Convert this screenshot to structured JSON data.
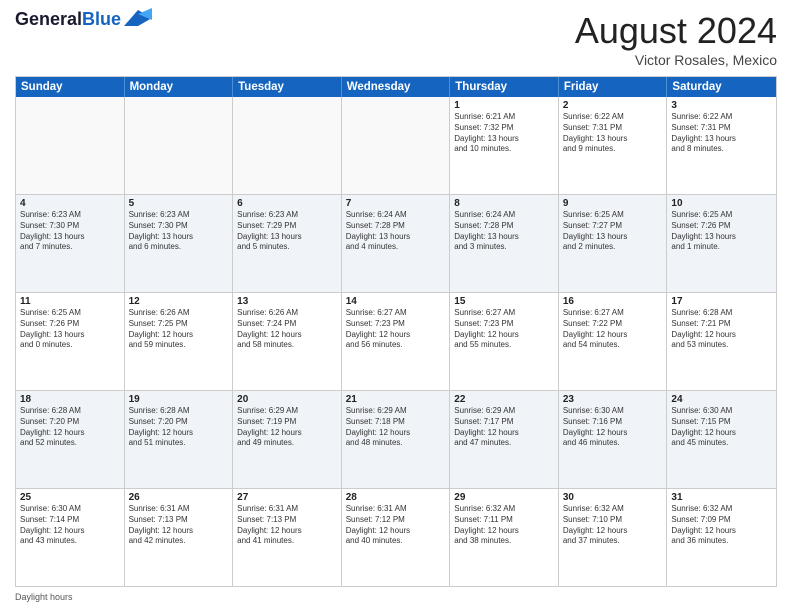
{
  "header": {
    "logo_line1": "General",
    "logo_line2": "Blue",
    "main_title": "August 2024",
    "subtitle": "Victor Rosales, Mexico"
  },
  "calendar": {
    "days_of_week": [
      "Sunday",
      "Monday",
      "Tuesday",
      "Wednesday",
      "Thursday",
      "Friday",
      "Saturday"
    ],
    "weeks": [
      [
        {
          "day": "",
          "empty": true
        },
        {
          "day": "",
          "empty": true
        },
        {
          "day": "",
          "empty": true
        },
        {
          "day": "",
          "empty": true
        },
        {
          "day": "1",
          "lines": [
            "Sunrise: 6:21 AM",
            "Sunset: 7:32 PM",
            "Daylight: 13 hours",
            "and 10 minutes."
          ]
        },
        {
          "day": "2",
          "lines": [
            "Sunrise: 6:22 AM",
            "Sunset: 7:31 PM",
            "Daylight: 13 hours",
            "and 9 minutes."
          ]
        },
        {
          "day": "3",
          "lines": [
            "Sunrise: 6:22 AM",
            "Sunset: 7:31 PM",
            "Daylight: 13 hours",
            "and 8 minutes."
          ]
        }
      ],
      [
        {
          "day": "4",
          "lines": [
            "Sunrise: 6:23 AM",
            "Sunset: 7:30 PM",
            "Daylight: 13 hours",
            "and 7 minutes."
          ]
        },
        {
          "day": "5",
          "lines": [
            "Sunrise: 6:23 AM",
            "Sunset: 7:30 PM",
            "Daylight: 13 hours",
            "and 6 minutes."
          ]
        },
        {
          "day": "6",
          "lines": [
            "Sunrise: 6:23 AM",
            "Sunset: 7:29 PM",
            "Daylight: 13 hours",
            "and 5 minutes."
          ]
        },
        {
          "day": "7",
          "lines": [
            "Sunrise: 6:24 AM",
            "Sunset: 7:28 PM",
            "Daylight: 13 hours",
            "and 4 minutes."
          ]
        },
        {
          "day": "8",
          "lines": [
            "Sunrise: 6:24 AM",
            "Sunset: 7:28 PM",
            "Daylight: 13 hours",
            "and 3 minutes."
          ]
        },
        {
          "day": "9",
          "lines": [
            "Sunrise: 6:25 AM",
            "Sunset: 7:27 PM",
            "Daylight: 13 hours",
            "and 2 minutes."
          ]
        },
        {
          "day": "10",
          "lines": [
            "Sunrise: 6:25 AM",
            "Sunset: 7:26 PM",
            "Daylight: 13 hours",
            "and 1 minute."
          ]
        }
      ],
      [
        {
          "day": "11",
          "lines": [
            "Sunrise: 6:25 AM",
            "Sunset: 7:26 PM",
            "Daylight: 13 hours",
            "and 0 minutes."
          ]
        },
        {
          "day": "12",
          "lines": [
            "Sunrise: 6:26 AM",
            "Sunset: 7:25 PM",
            "Daylight: 12 hours",
            "and 59 minutes."
          ]
        },
        {
          "day": "13",
          "lines": [
            "Sunrise: 6:26 AM",
            "Sunset: 7:24 PM",
            "Daylight: 12 hours",
            "and 58 minutes."
          ]
        },
        {
          "day": "14",
          "lines": [
            "Sunrise: 6:27 AM",
            "Sunset: 7:23 PM",
            "Daylight: 12 hours",
            "and 56 minutes."
          ]
        },
        {
          "day": "15",
          "lines": [
            "Sunrise: 6:27 AM",
            "Sunset: 7:23 PM",
            "Daylight: 12 hours",
            "and 55 minutes."
          ]
        },
        {
          "day": "16",
          "lines": [
            "Sunrise: 6:27 AM",
            "Sunset: 7:22 PM",
            "Daylight: 12 hours",
            "and 54 minutes."
          ]
        },
        {
          "day": "17",
          "lines": [
            "Sunrise: 6:28 AM",
            "Sunset: 7:21 PM",
            "Daylight: 12 hours",
            "and 53 minutes."
          ]
        }
      ],
      [
        {
          "day": "18",
          "lines": [
            "Sunrise: 6:28 AM",
            "Sunset: 7:20 PM",
            "Daylight: 12 hours",
            "and 52 minutes."
          ]
        },
        {
          "day": "19",
          "lines": [
            "Sunrise: 6:28 AM",
            "Sunset: 7:20 PM",
            "Daylight: 12 hours",
            "and 51 minutes."
          ]
        },
        {
          "day": "20",
          "lines": [
            "Sunrise: 6:29 AM",
            "Sunset: 7:19 PM",
            "Daylight: 12 hours",
            "and 49 minutes."
          ]
        },
        {
          "day": "21",
          "lines": [
            "Sunrise: 6:29 AM",
            "Sunset: 7:18 PM",
            "Daylight: 12 hours",
            "and 48 minutes."
          ]
        },
        {
          "day": "22",
          "lines": [
            "Sunrise: 6:29 AM",
            "Sunset: 7:17 PM",
            "Daylight: 12 hours",
            "and 47 minutes."
          ]
        },
        {
          "day": "23",
          "lines": [
            "Sunrise: 6:30 AM",
            "Sunset: 7:16 PM",
            "Daylight: 12 hours",
            "and 46 minutes."
          ]
        },
        {
          "day": "24",
          "lines": [
            "Sunrise: 6:30 AM",
            "Sunset: 7:15 PM",
            "Daylight: 12 hours",
            "and 45 minutes."
          ]
        }
      ],
      [
        {
          "day": "25",
          "lines": [
            "Sunrise: 6:30 AM",
            "Sunset: 7:14 PM",
            "Daylight: 12 hours",
            "and 43 minutes."
          ]
        },
        {
          "day": "26",
          "lines": [
            "Sunrise: 6:31 AM",
            "Sunset: 7:13 PM",
            "Daylight: 12 hours",
            "and 42 minutes."
          ]
        },
        {
          "day": "27",
          "lines": [
            "Sunrise: 6:31 AM",
            "Sunset: 7:13 PM",
            "Daylight: 12 hours",
            "and 41 minutes."
          ]
        },
        {
          "day": "28",
          "lines": [
            "Sunrise: 6:31 AM",
            "Sunset: 7:12 PM",
            "Daylight: 12 hours",
            "and 40 minutes."
          ]
        },
        {
          "day": "29",
          "lines": [
            "Sunrise: 6:32 AM",
            "Sunset: 7:11 PM",
            "Daylight: 12 hours",
            "and 38 minutes."
          ]
        },
        {
          "day": "30",
          "lines": [
            "Sunrise: 6:32 AM",
            "Sunset: 7:10 PM",
            "Daylight: 12 hours",
            "and 37 minutes."
          ]
        },
        {
          "day": "31",
          "lines": [
            "Sunrise: 6:32 AM",
            "Sunset: 7:09 PM",
            "Daylight: 12 hours",
            "and 36 minutes."
          ]
        }
      ]
    ]
  },
  "footer": {
    "daylight_label": "Daylight hours"
  }
}
